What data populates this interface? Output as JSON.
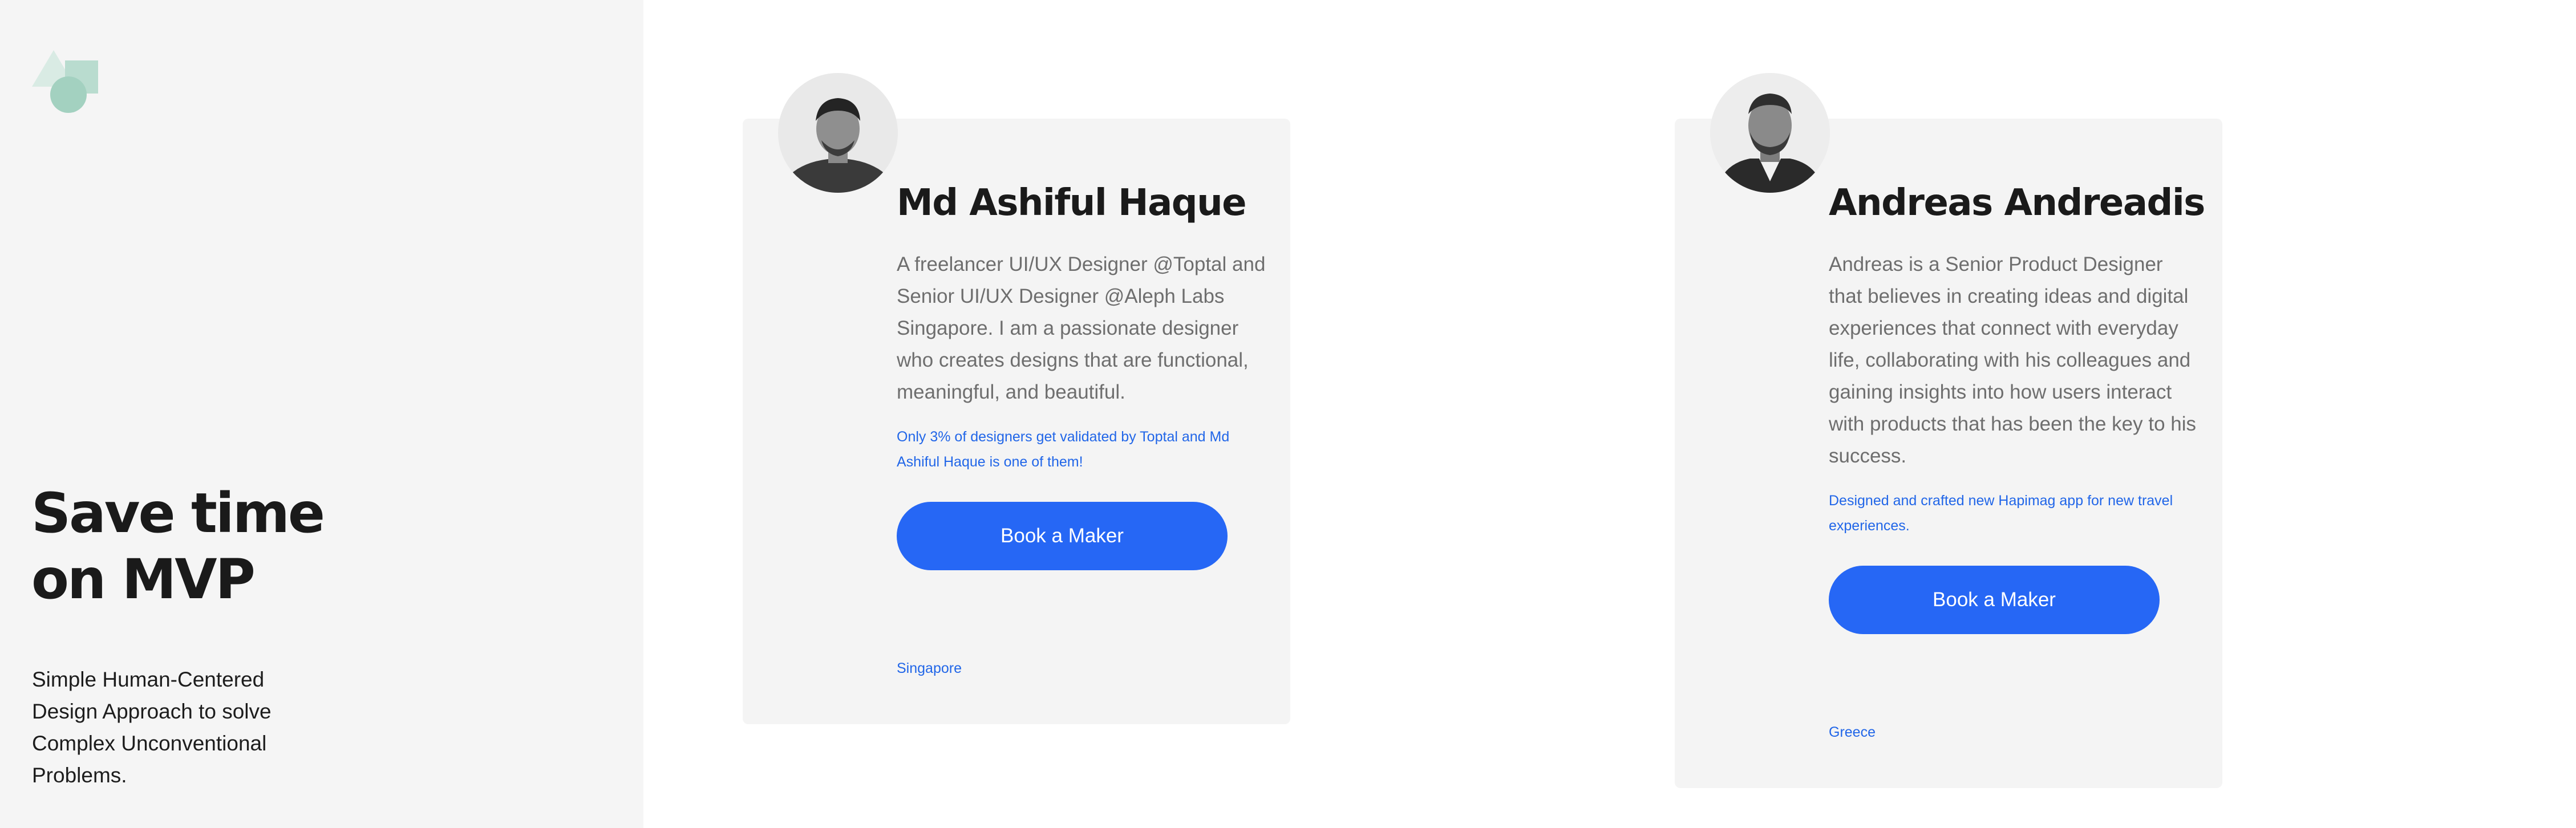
{
  "hero": {
    "headline_line1": "Save time",
    "headline_line2": "on MVP",
    "tagline": "Simple Human-Centered Design Approach to solve Complex Unconventional Problems."
  },
  "logo": {
    "icon": "shapes-logo-icon",
    "colors": {
      "triangle": "#d9ebe4",
      "square": "#b9dccf",
      "circle": "#a3d1c0"
    }
  },
  "makers": [
    {
      "name": "Md Ashiful Haque",
      "avatar_icon": "avatar-icon",
      "bio": "A freelancer UI/UX Designer @Toptal and Senior UI/UX Designer @Aleph Labs Singapore. I am a passionate designer who creates designs that are functional, meaningful, and beautiful.",
      "highlight": "Only 3% of designers get validated by Toptal and Md Ashiful Haque is one of them!",
      "button_label": "Book a Maker",
      "location": "Singapore"
    },
    {
      "name": "Andreas Andreadis",
      "avatar_icon": "avatar-icon",
      "bio": "Andreas is a Senior Product Designer that believes in creating ideas and digital experiences that connect with everyday life, collaborating with his colleagues and gaining insights into how users interact with products that has been the key to his success.",
      "highlight": "Designed and crafted new Hapimag app for new travel experiences.",
      "button_label": "Book a Maker",
      "location": "Greece"
    }
  ],
  "colors": {
    "accent": "#2667f5",
    "link": "#2166e8",
    "sidebar_bg": "#f5f5f5",
    "card_bg": "#f4f4f4"
  }
}
